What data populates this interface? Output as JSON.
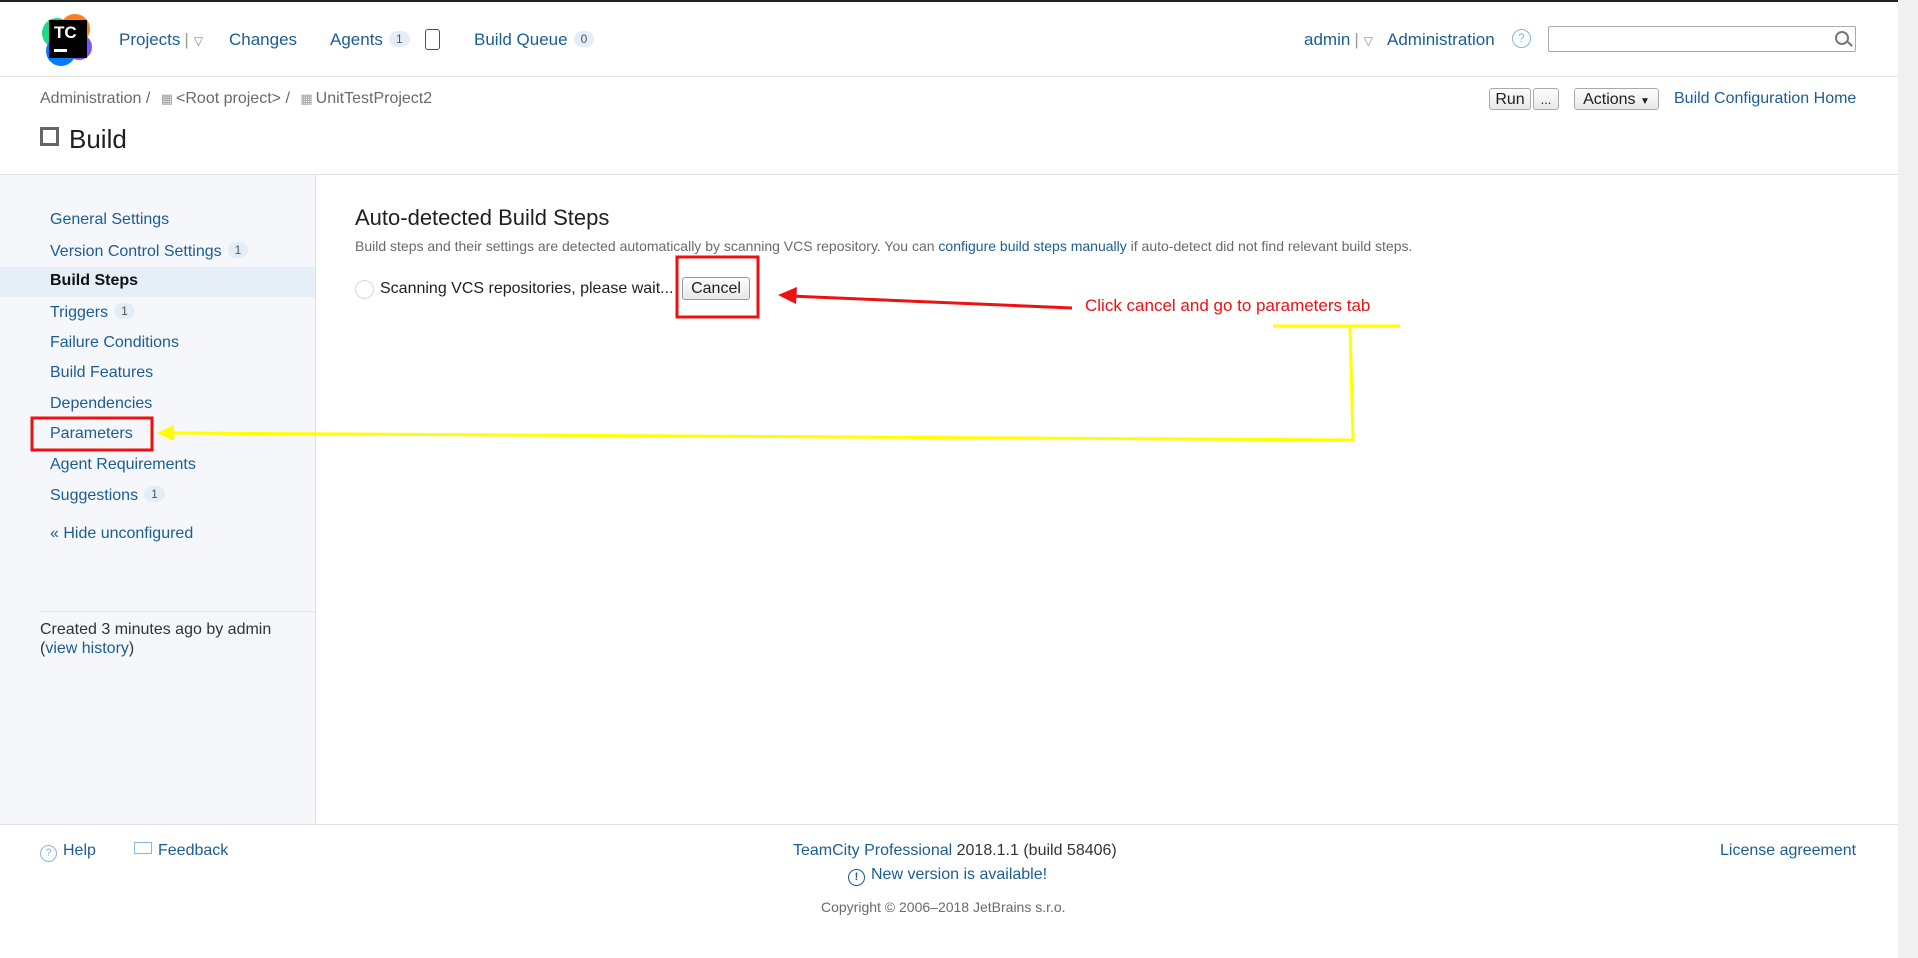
{
  "topnav": {
    "logo_text": "TC",
    "projects": "Projects",
    "changes": "Changes",
    "agents": "Agents",
    "agents_count": "1",
    "build_queue": "Build Queue",
    "build_queue_count": "0",
    "user": "admin",
    "administration": "Administration",
    "search_placeholder": ""
  },
  "breadcrumb": {
    "items": [
      "Administration",
      "<Root project>",
      "UnitTestProject2"
    ],
    "separator": "/"
  },
  "page": {
    "title": "Build"
  },
  "toolbar": {
    "run": "Run",
    "more": "...",
    "actions": "Actions",
    "build_config_home": "Build Configuration Home"
  },
  "sidebar": {
    "items": [
      {
        "label": "General Settings",
        "count": ""
      },
      {
        "label": "Version Control Settings",
        "count": "1"
      },
      {
        "label": "Build Steps",
        "count": ""
      },
      {
        "label": "Triggers",
        "count": "1"
      },
      {
        "label": "Failure Conditions",
        "count": ""
      },
      {
        "label": "Build Features",
        "count": ""
      },
      {
        "label": "Dependencies",
        "count": ""
      },
      {
        "label": "Parameters",
        "count": ""
      },
      {
        "label": "Agent Requirements",
        "count": ""
      },
      {
        "label": "Suggestions",
        "count": "1"
      }
    ],
    "hide_unconfigured": "« Hide unconfigured",
    "created_prefix": "Created 3 minutes ago by admin",
    "open_paren": "(",
    "view_history": "view history",
    "close_paren": ")"
  },
  "main": {
    "heading": "Auto-detected Build Steps",
    "desc_before": "Build steps and their settings are detected automatically by scanning VCS repository. You can ",
    "desc_link": "configure build steps manually",
    "desc_after": " if auto-detect did not find relevant build steps.",
    "scanning": "Scanning VCS repositories, please wait...",
    "cancel": "Cancel"
  },
  "annotation": {
    "text": "Click cancel and go to parameters tab",
    "red_color": "#ee1111",
    "yellow_color": "#ffff00"
  },
  "footer": {
    "help": "Help",
    "feedback": "Feedback",
    "product": "TeamCity Professional",
    "version": " 2018.1.1 (build 58406)",
    "new_version": "New version is available!",
    "copyright": "Copyright © 2006–2018 JetBrains s.r.o.",
    "license": "License agreement"
  },
  "colors": {
    "link": "#1b5d94",
    "sidebar_bg": "#f5f7fa",
    "active_item_bg": "#e6eef7"
  }
}
